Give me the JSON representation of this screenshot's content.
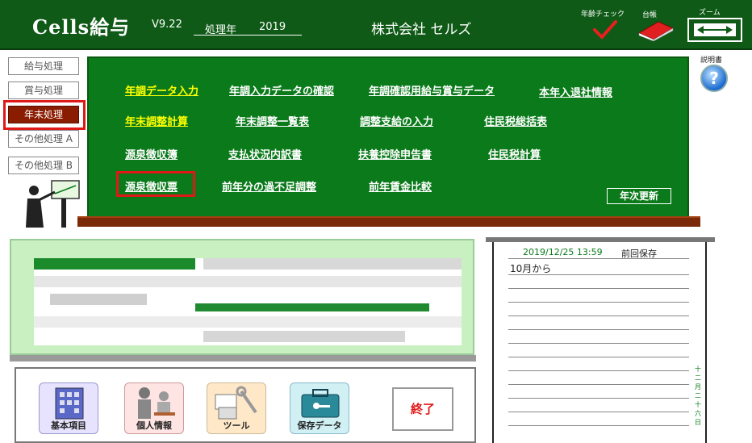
{
  "header": {
    "app_title": "Cells給与",
    "version": "V9.22",
    "year_label": "処理年",
    "year_value": "2019",
    "company": "株式会社 セルズ",
    "age_check_label": "年齢チェック",
    "ledger_label": "台帳",
    "zoom_label": "ズーム"
  },
  "sidebar": {
    "items": [
      {
        "label": "給与処理"
      },
      {
        "label": "賞与処理"
      },
      {
        "label": "年末処理"
      },
      {
        "label": "その他処理 A"
      },
      {
        "label": "その他処理 B"
      }
    ]
  },
  "menu": {
    "row1": [
      "年調データ入力",
      "年調入力データの確認",
      "年調確認用給与賞与データ",
      "本年入退社情報"
    ],
    "row2": [
      "年末調整計算",
      "年末調整一覧表",
      "調整支給の入力",
      "住民税総括表"
    ],
    "row3": [
      "源泉徴収簿",
      "支払状況内訳書",
      "扶養控除申告書",
      "住民税計算"
    ],
    "row4": [
      "源泉徴収票",
      "前年分の過不足調整",
      "前年賃金比較"
    ],
    "annual_update": "年次更新"
  },
  "help": {
    "label": "説明書",
    "icon_glyph": "?"
  },
  "bottom": {
    "buttons": [
      "基本項目",
      "個人情報",
      "ツール",
      "保存データ"
    ],
    "exit": "終了"
  },
  "memo": {
    "date": "2019/12/25 13:59",
    "date_label": "前回保存",
    "line1": "10月から",
    "vertical_text": "十二月二十六日"
  },
  "colors": {
    "header_bg": "#0e5a16",
    "board_bg": "#0a7a1a",
    "highlight": "#e01818",
    "active_side": "#8a1c00",
    "link_yellow": "#ffff00"
  }
}
